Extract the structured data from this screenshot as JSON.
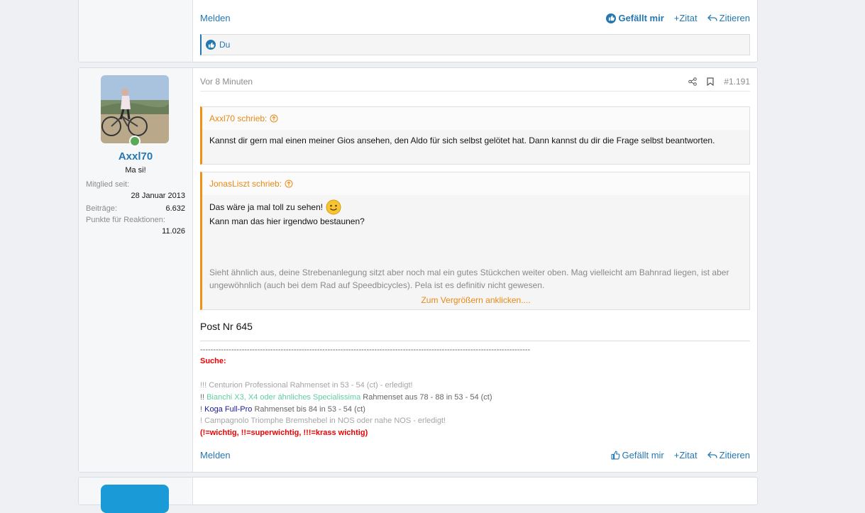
{
  "prev_post": {
    "report": "Melden",
    "liked": "Gefällt mir",
    "quote": "+Zitat",
    "reply": "Zitieren",
    "reactions_text": "Du"
  },
  "post": {
    "user": {
      "name": "Axxl70",
      "title": "Ma si!",
      "stats": [
        {
          "label": "Mitglied seit:",
          "value": "28 Januar 2013"
        },
        {
          "label": "Beiträge:",
          "value": "6.632"
        },
        {
          "label": "Punkte für Reaktionen:",
          "value": "11.026"
        }
      ]
    },
    "time": "Vor 8 Minuten",
    "number": "#1.191",
    "quote1": {
      "author": "Axxl70 schrieb:",
      "text": "Kannst dir gern mal einen meiner Gios ansehen, den Aldo für sich selbst gelötet hat. Dann kannst du dir die Frage selbst beantworten."
    },
    "quote2": {
      "author": "JonasLiszt schrieb:",
      "line1": "Das wäre ja mal toll zu sehen!",
      "line2": "Kann man das hier irgendwo bestaunen?",
      "faded": "Sieht ähnlich aus, deine Strebenanlegung sitzt aber noch mal ein gutes Stückchen weiter oben. Mag vielleicht am Bahnrad liegen, ist aber ungewöhnlich (auch bei dem Rad auf Speedbicycles). Pela ist es definitiv nicht gewesen.",
      "expand": "Zum Vergrößern anklicken...."
    },
    "body": "Post Nr 645",
    "signature": {
      "dashes": "-------------------------------------------------------------------------------------------------------------------------------",
      "heading": "Suche:",
      "l1": "!!! Centurion Professional Rahmenset in 53 - 54 (ct) - erledigt!",
      "l2_prefix": "!! ",
      "l2_highlight": "Bianchi X3, X4 oder ähnliches Specialissima",
      "l2_rest": " Rahmenset aus 78 - 88 in 53 - 54 (ct)",
      "l3_prefix": "! ",
      "l3_highlight": "Koga Full-Pro",
      "l3_rest": " Rahmenset bis 84 in 53 - 54 (ct)",
      "l4": "! Campagnolo Triomphe Bremshebel in NOS oder nahe NOS - erledigt!",
      "l5": "(!=wichtig, !!=superwichtig, !!!=krass wichtig)"
    },
    "actions": {
      "report": "Melden",
      "like": "Gefällt mir",
      "quote": "+Zitat",
      "reply": "Zitieren"
    }
  },
  "colors": {
    "link": "#2577b1",
    "quote_accent": "#f19014",
    "online": "#5aa85a"
  }
}
